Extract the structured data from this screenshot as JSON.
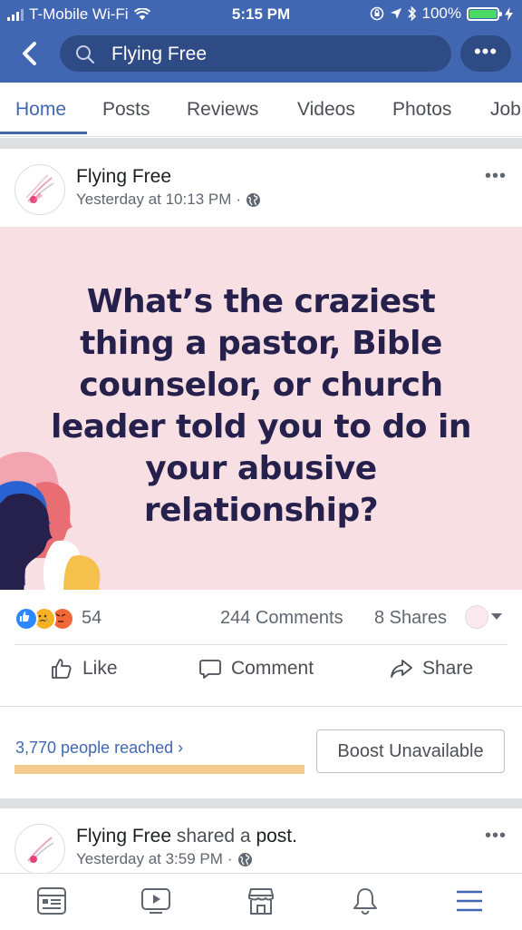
{
  "status_bar": {
    "carrier": "T-Mobile Wi-Fi",
    "time": "5:15 PM",
    "battery": "100%",
    "battery_level": 1.0
  },
  "header": {
    "search_text": "Flying Free",
    "more_label": "•••"
  },
  "tabs": [
    "Home",
    "Posts",
    "Reviews",
    "Videos",
    "Photos",
    "Job"
  ],
  "active_tab": "Home",
  "post1": {
    "page_name": "Flying Free",
    "timestamp": "Yesterday at 10:13 PM",
    "separator": "·",
    "more_label": "•••",
    "headline": "What’s the craziest thing a pastor, Bible counselor, or church leader told you to do in your abusive relationship?",
    "reaction_count": "54",
    "comments": "244 Comments",
    "shares": "8 Shares",
    "actions": {
      "like": "Like",
      "comment": "Comment",
      "share": "Share"
    },
    "reach": "3,770 people reached",
    "reach_chevron": "›",
    "boost": "Boost Unavailable"
  },
  "post2": {
    "page_name": "Flying Free",
    "shared_text": "shared a",
    "shared_object": "post.",
    "timestamp": "Yesterday at 3:59 PM",
    "separator": "·",
    "more_label": "•••"
  },
  "colors": {
    "brand": "#4267b2",
    "banner_bg": "#f7dfe3",
    "headline": "#26214c",
    "reach_bar": "#f4c98a"
  },
  "icons": {
    "bottom_nav": [
      "news-feed-icon",
      "watch-icon",
      "marketplace-icon",
      "notifications-icon",
      "menu-icon"
    ]
  }
}
